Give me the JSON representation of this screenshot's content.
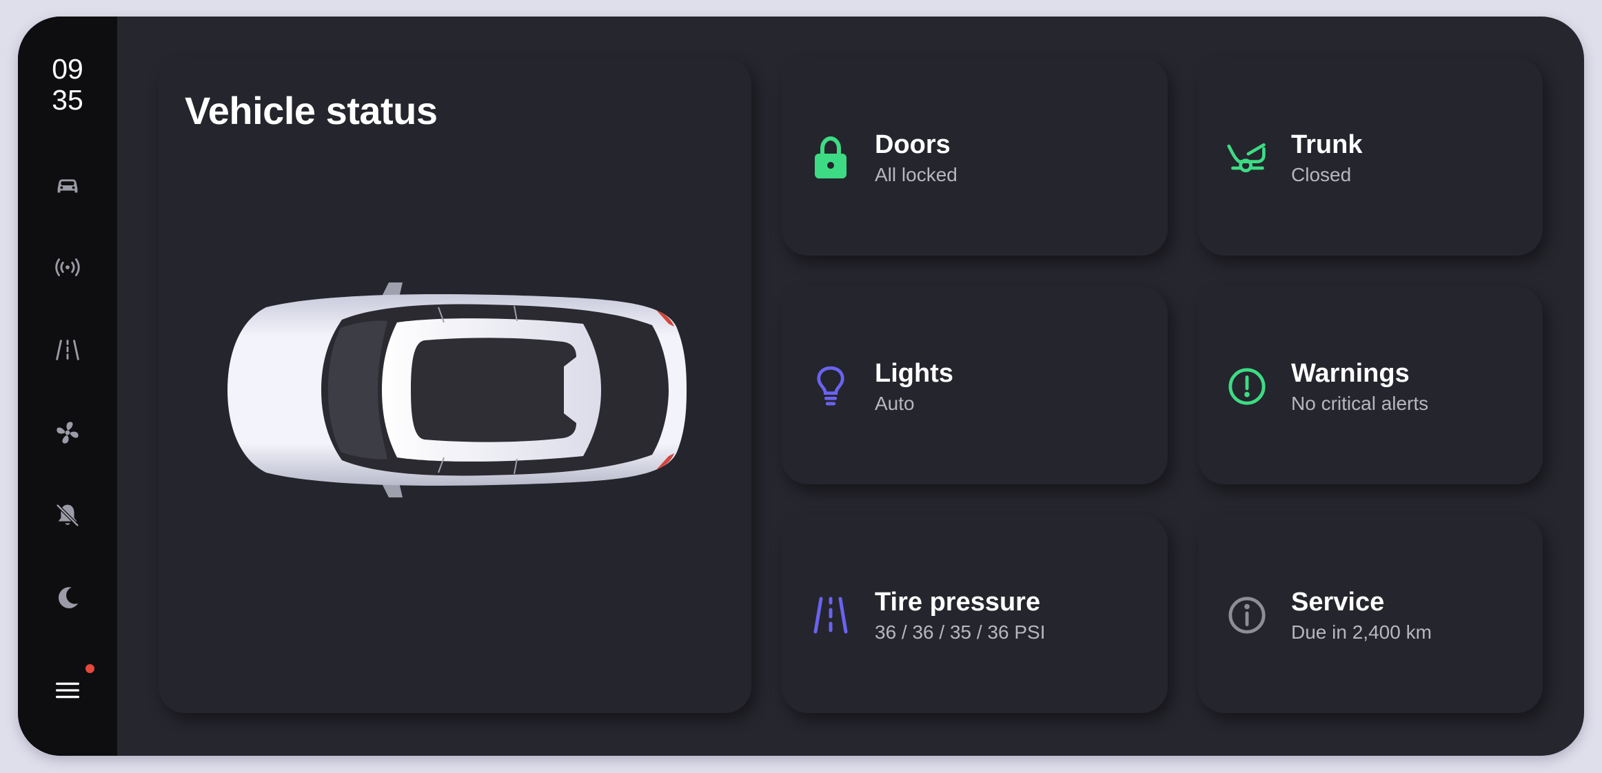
{
  "clock": {
    "hour": "09",
    "minute": "35"
  },
  "sidebar": {
    "icons": [
      "car-icon",
      "broadcast-icon",
      "road-icon",
      "fan-icon",
      "bell-off-icon",
      "moon-icon",
      "menu-icon"
    ],
    "menu_notification_color": "#e5483d"
  },
  "vehicle": {
    "title": "Vehicle status",
    "image": "car-top-view"
  },
  "tiles": [
    {
      "title": "Doors",
      "status": "All locked",
      "icon": "lock-icon",
      "color": "#3ddc84"
    },
    {
      "title": "Trunk",
      "status": "Closed",
      "icon": "trunk-icon",
      "color": "#3ddc84"
    },
    {
      "title": "Lights",
      "status": "Auto",
      "icon": "lightbulb-icon",
      "color": "#6a63f0"
    },
    {
      "title": "Warnings",
      "status": "No critical alerts",
      "icon": "alert-circle-icon",
      "color": "#3ddc84"
    },
    {
      "title": "Tire pressure",
      "status": "36 / 36 / 35 / 36 PSI",
      "icon": "tire-road-icon",
      "color": "#6a63f0"
    },
    {
      "title": "Service",
      "status": "Due in 2,400 km",
      "icon": "info-icon",
      "color": "#8e8e98"
    }
  ],
  "colors": {
    "background": "#dfdfec",
    "panel": "#26262e",
    "sidebar": "#0e0e10",
    "card": "#25252d",
    "accent_green": "#3ddc84",
    "accent_purple": "#6a63f0"
  }
}
